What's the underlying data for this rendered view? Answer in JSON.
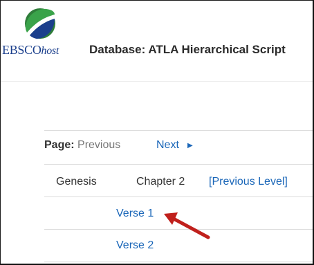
{
  "brand": {
    "name_caps": "EBSCO",
    "name_italic": "host"
  },
  "database": {
    "title": "Database: ATLA Hierarchical Script"
  },
  "pager": {
    "label": "Page:",
    "previous": "Previous",
    "next": "Next"
  },
  "hierarchy": {
    "book": "Genesis",
    "chapter": "Chapter 2",
    "previous_level": "[Previous Level]"
  },
  "verses": [
    "Verse 1",
    "Verse 2"
  ],
  "colors": {
    "link": "#1a66b8",
    "annotation_arrow": "#c0201c",
    "logo_green": "#3aa34a",
    "logo_blue": "#1b3f8c"
  }
}
